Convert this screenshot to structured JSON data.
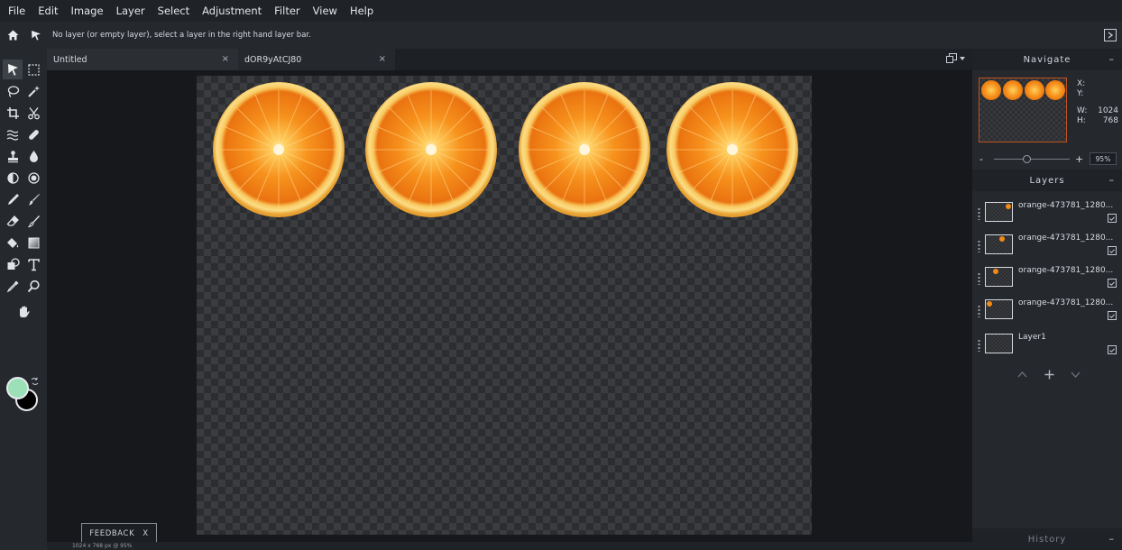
{
  "menu": [
    "File",
    "Edit",
    "Image",
    "Layer",
    "Select",
    "Adjustment",
    "Filter",
    "View",
    "Help"
  ],
  "options_bar": {
    "message": "No layer (or empty layer), select a layer in the right hand layer bar."
  },
  "tabs": [
    {
      "label": "Untitled",
      "close": "×",
      "active": true
    },
    {
      "label": "dOR9yAtCJ80",
      "close": "×",
      "active": false
    }
  ],
  "toolbar": {
    "tools": [
      "move-tool",
      "marquee-tool",
      "lasso-tool",
      "magic-wand-tool",
      "crop-tool",
      "slice-tool",
      "smudge-tool",
      "heal-tool",
      "clone-stamp-tool",
      "blur-tool",
      "sponge-tool",
      "dodge-tool",
      "pen-tool",
      "brush-tool",
      "eraser-tool",
      "color-replace-tool",
      "fill-tool",
      "gradient-tool",
      "shape-tool",
      "text-tool",
      "eyedropper-tool",
      "zoom-tool",
      "hand-tool"
    ],
    "foreground_color": "#9be0b6",
    "background_color": "#000000"
  },
  "canvas": {
    "status": "1024 x 768 px @ 95%",
    "feedback_label": "FEEDBACK",
    "feedback_close": "X",
    "oranges": 4
  },
  "navigate": {
    "title": "Navigate",
    "minimize": "–",
    "x_label": "X:",
    "y_label": "Y:",
    "w_label": "W:",
    "w_value": "1024",
    "h_label": "H:",
    "h_value": "768",
    "zoom_minus": "-",
    "zoom_plus": "+",
    "zoom_value": "95%",
    "zoom_level_percent": 95
  },
  "layers": {
    "title": "Layers",
    "minimize": "–",
    "items": [
      {
        "name": "orange-473781_1280...",
        "visible": true
      },
      {
        "name": "orange-473781_1280...",
        "visible": true
      },
      {
        "name": "orange-473781_1280...",
        "visible": true
      },
      {
        "name": "orange-473781_1280...",
        "visible": true
      },
      {
        "name": "Layer1",
        "visible": true
      }
    ]
  },
  "history": {
    "title": "History",
    "minimize": "–"
  },
  "colors": {
    "accent": "#c0521f",
    "orange": "#f7931e"
  }
}
